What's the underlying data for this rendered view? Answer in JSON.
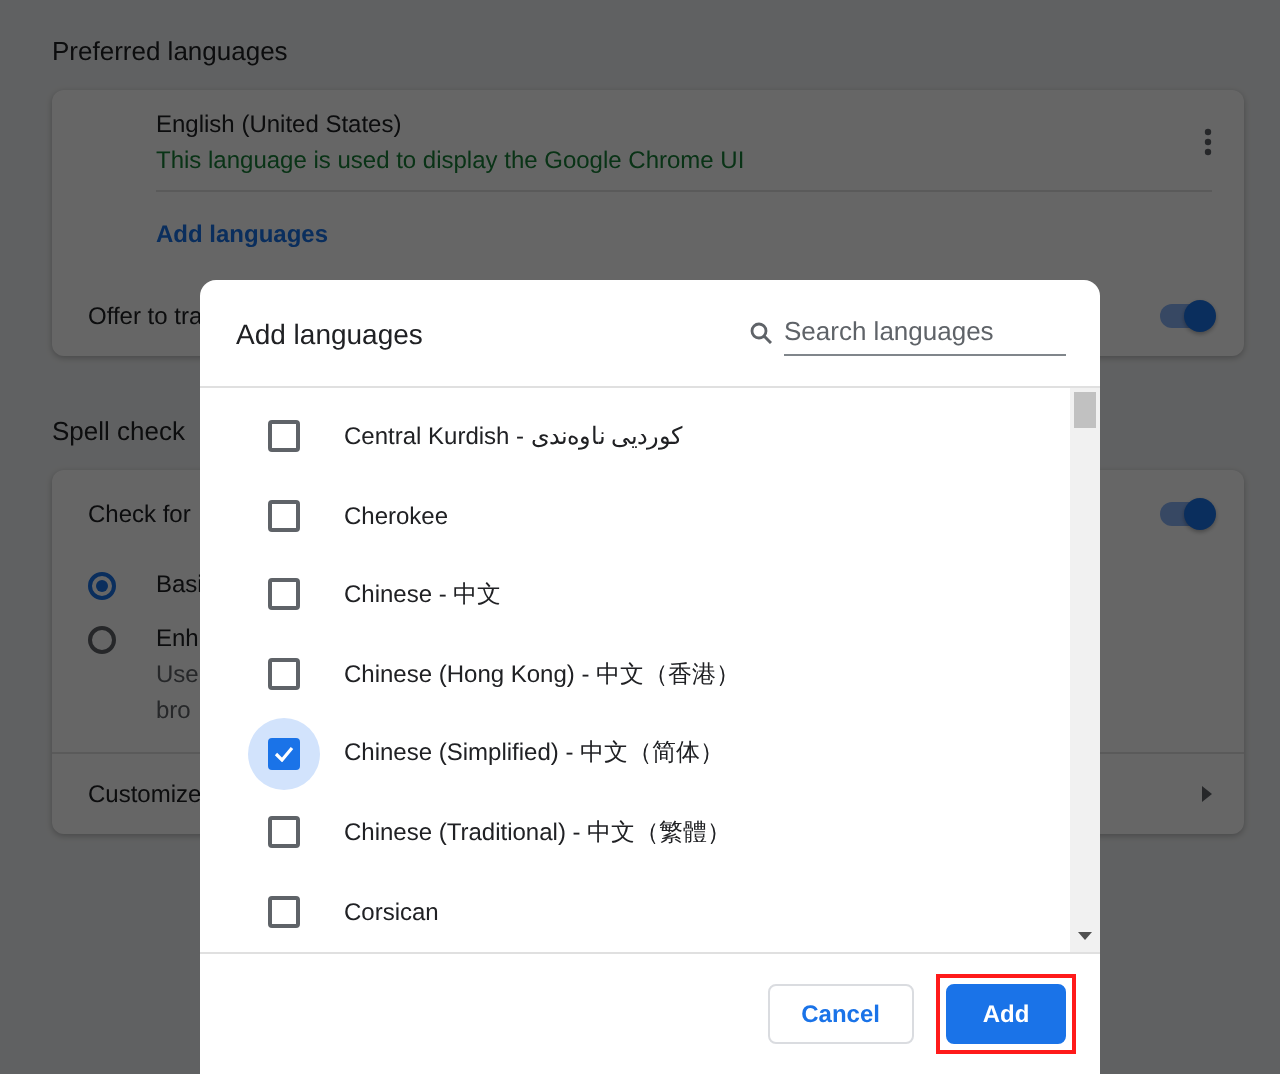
{
  "settings": {
    "preferred_languages": {
      "heading": "Preferred languages",
      "language": {
        "name": "English (United States)",
        "note": "This language is used to display the Google Chrome UI"
      },
      "add_link": "Add languages",
      "offer_translate": {
        "label": "Offer to tra",
        "on": true
      }
    },
    "spell_check": {
      "heading": "Spell check",
      "check": {
        "label": "Check for",
        "on": true
      },
      "options": [
        {
          "label": "Basi",
          "selected": true
        },
        {
          "label": "Enh",
          "description": [
            "Use",
            "bro"
          ],
          "selected": false
        }
      ],
      "customize": "Customize"
    }
  },
  "dialog": {
    "title": "Add languages",
    "search": {
      "placeholder": "Search languages"
    },
    "languages": [
      {
        "label": "Central Kurdish - کوردیی ناوەندی",
        "checked": false
      },
      {
        "label": "Cherokee",
        "checked": false
      },
      {
        "label": "Chinese - 中文",
        "checked": false
      },
      {
        "label": "Chinese (Hong Kong) - 中文（香港）",
        "checked": false
      },
      {
        "label": "Chinese (Simplified) - 中文（简体）",
        "checked": true
      },
      {
        "label": "Chinese (Traditional) - 中文（繁體）",
        "checked": false
      },
      {
        "label": "Corsican",
        "checked": false
      }
    ],
    "buttons": [
      {
        "label": "Cancel",
        "kind": "secondary",
        "highlighted": false
      },
      {
        "label": "Add",
        "kind": "primary",
        "highlighted": true
      }
    ]
  }
}
